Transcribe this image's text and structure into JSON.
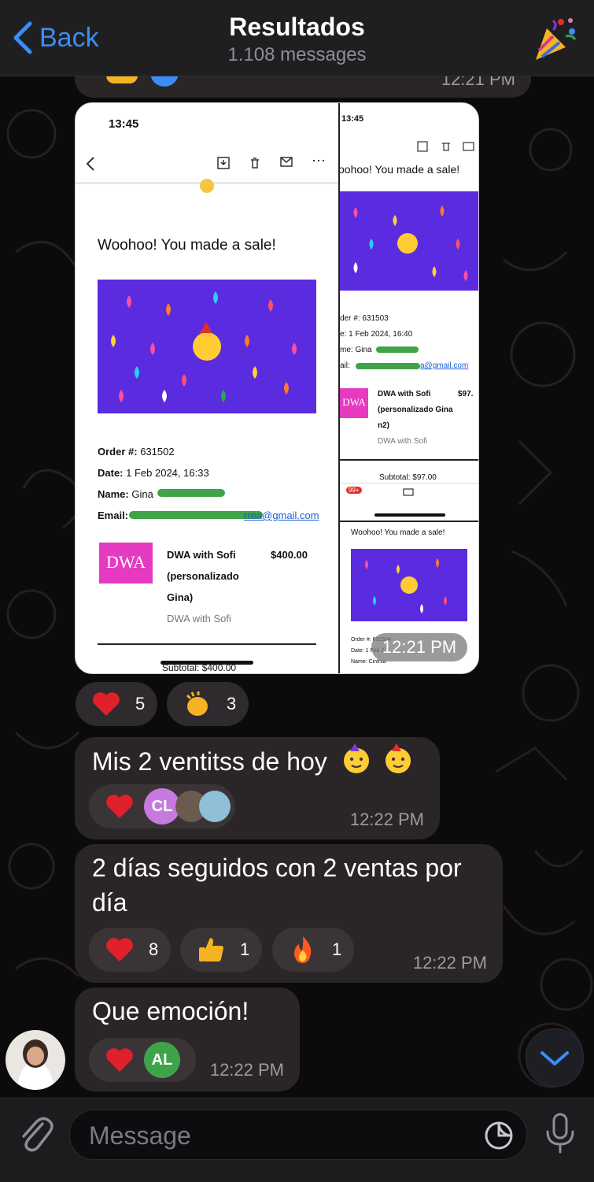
{
  "header": {
    "back_label": "Back",
    "title": "Resultados",
    "subtitle": "1.108 messages"
  },
  "previous_message": {
    "time": "12:21 PM"
  },
  "media_message": {
    "time": "12:21 PM",
    "left_screenshot": {
      "status_time": "13:45",
      "heading": "Woohoo! You made a sale!",
      "order_label": "Order #:",
      "order_value": "631502",
      "date_label": "Date:",
      "date_value": "1 Feb 2024, 16:33",
      "name_label": "Name:",
      "name_value": "Gina",
      "email_label": "Email:",
      "email_value": "rrea@gmail.com",
      "product_logo": "DWA",
      "product_name": "DWA with Sofi",
      "product_detail_1": "(personalizado",
      "product_detail_2": "Gina)",
      "product_price": "$400.00",
      "product_seller": "DWA with Sofi",
      "subtotal": "Subtotal: $400.00"
    },
    "right_screenshot_top": {
      "status_time": "13:45",
      "heading": "oohoo! You made a sale!",
      "order": "der #: 631503",
      "date": "e: 1 Feb 2024, 16:40",
      "name": "me: Gina",
      "email": "ail:",
      "email_value": "a@gmail.com",
      "product_logo": "DWA",
      "product_name": "DWA with Sofi",
      "product_detail_1": "(personalizado Gina",
      "product_detail_2": "n2)",
      "product_price": "$97.",
      "product_seller": "DWA with Sofi",
      "subtotal": "Subtotal: $97.00",
      "badge": "99+"
    },
    "right_screenshot_bottom": {
      "heading": "Woohoo! You made a sale!",
      "order": "Order #: 631504",
      "date": "Date: 1 Feb 2",
      "name": "Name: Cinthia"
    },
    "reactions": [
      {
        "emoji": "red-heart",
        "count": "5"
      },
      {
        "emoji": "clapping-hands",
        "count": "3"
      }
    ]
  },
  "messages": [
    {
      "text": "Mis 2 ventitss de hoy",
      "time": "12:22 PM",
      "reaction_emoji": "red-heart",
      "reactor_initials": "CL"
    },
    {
      "text_line1": "2 días seguidos con 2 ventas por",
      "text_line2": "día",
      "time": "12:22 PM",
      "reactions": [
        {
          "emoji": "red-heart",
          "count": "8"
        },
        {
          "emoji": "thumbs-up",
          "count": "1"
        },
        {
          "emoji": "fire",
          "count": "1"
        }
      ]
    },
    {
      "text": "Que emoción!",
      "time": "12:22 PM",
      "reaction_emoji": "red-heart",
      "reactor_initials": "AL"
    }
  ],
  "input": {
    "placeholder": "Message"
  },
  "colors": {
    "accent": "#3a8ef6",
    "bubble": "#2a2628",
    "heart": "#e0202a",
    "confetti_bg": "#5b2be0"
  }
}
